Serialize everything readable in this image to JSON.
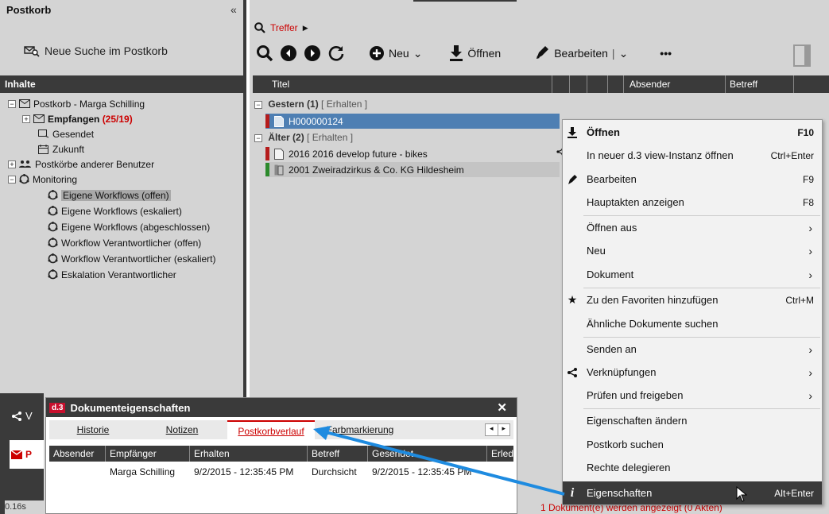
{
  "left": {
    "title": "Postkorb",
    "collapse": "«",
    "new_search": "Neue Suche im Postkorb",
    "section": "Inhalte",
    "tree": [
      {
        "label": "Postkorb - Marga Schilling"
      },
      {
        "label": "Empfangen",
        "count": "(25/19)"
      },
      {
        "label": "Gesendet"
      },
      {
        "label": "Zukunft"
      },
      {
        "label": "Postkörbe anderer Benutzer"
      },
      {
        "label": "Monitoring"
      },
      {
        "label": "Eigene Workflows (offen)"
      },
      {
        "label": "Eigene Workflows (eskaliert)"
      },
      {
        "label": "Eigene Workflows (abgeschlossen)"
      },
      {
        "label": "Workflow Verantwortlicher (offen)"
      },
      {
        "label": "Workflow Verantwortlicher (eskaliert)"
      },
      {
        "label": "Eskalation Verantwortlicher"
      }
    ],
    "status_time": "0.16s",
    "partial_v": "V",
    "partial_p": "P"
  },
  "right": {
    "breadcrumb": "Treffer",
    "toolbar": {
      "neu": "Neu",
      "oeffnen": "Öffnen",
      "bearbeiten": "Bearbeiten",
      "more": "•••"
    },
    "columns": {
      "titel": "Titel",
      "absender": "Absender",
      "betreff": "Betreff"
    },
    "groups": [
      {
        "label": "Gestern (1)",
        "link": "[ Erhalten ]"
      },
      {
        "label": "Älter (2)",
        "link": "[ Erhalten ]"
      }
    ],
    "rows": [
      {
        "title": "H000000124"
      },
      {
        "title": "2016 2016 develop future - bikes"
      },
      {
        "title": "2001 Zweiradzirkus & Co. KG Hildesheim"
      }
    ],
    "status": "1 Dokument(e) werden angezeigt (0 Akten)"
  },
  "context_menu": {
    "items": [
      {
        "label": "Öffnen",
        "shortcut": "F10"
      },
      {
        "label": "In neuer d.3 view-Instanz öffnen",
        "shortcut": "Ctrl+Enter"
      },
      {
        "label": "Bearbeiten",
        "shortcut": "F9"
      },
      {
        "label": "Hauptakten anzeigen",
        "shortcut": "F8"
      },
      {
        "label": "Öffnen aus"
      },
      {
        "label": "Neu"
      },
      {
        "label": "Dokument"
      },
      {
        "label": "Zu den Favoriten hinzufügen",
        "shortcut": "Ctrl+M"
      },
      {
        "label": "Ähnliche Dokumente suchen"
      },
      {
        "label": "Senden an"
      },
      {
        "label": "Verknüpfungen"
      },
      {
        "label": "Prüfen und freigeben"
      },
      {
        "label": "Eigenschaften ändern"
      },
      {
        "label": "Postkorb suchen"
      },
      {
        "label": "Rechte delegieren"
      },
      {
        "label": "Eigenschaften",
        "shortcut": "Alt+Enter"
      }
    ]
  },
  "dialog": {
    "logo": "d.3",
    "title": "Dokumenteigenschaften",
    "close": "✕",
    "tabs": [
      "Historie",
      "Notizen",
      "Postkorbverlauf",
      "Farbmarkierung"
    ],
    "columns": [
      "Absender",
      "Empfänger",
      "Erhalten",
      "Betreff",
      "Gesendet",
      "Erled"
    ],
    "row": {
      "empfaenger": "Marga Schilling",
      "erhalten": "9/2/2015 - 12:35:45 PM",
      "betreff": "Durchsicht",
      "gesendet": "9/2/2015 - 12:35:45 PM"
    }
  },
  "colors": {
    "accent_red": "#c00000",
    "dark_bar": "#3a3a3a",
    "selection_blue": "#4e7fb3",
    "arrow_blue": "#1e8be0"
  }
}
